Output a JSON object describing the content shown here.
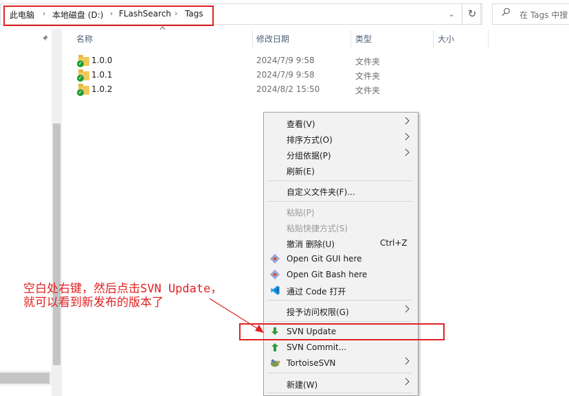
{
  "address_bar": {
    "breadcrumb": [
      "此电脑",
      "本地磁盘 (D:)",
      "FLashSearch",
      "Tags"
    ],
    "separator": "›",
    "dropdown_glyph": "⌄",
    "refresh_glyph": "↻"
  },
  "search": {
    "placeholder": "在 Tags 中搜",
    "icon": "search-icon"
  },
  "columns": {
    "name": "名称",
    "modified": "修改日期",
    "type": "类型",
    "size": "大小"
  },
  "files": [
    {
      "name": "1.0.0",
      "modified": "2024/7/9 9:58",
      "type": "文件夹"
    },
    {
      "name": "1.0.1",
      "modified": "2024/7/9 9:58",
      "type": "文件夹"
    },
    {
      "name": "1.0.2",
      "modified": "2024/8/2 15:50",
      "type": "文件夹"
    }
  ],
  "context_menu": {
    "view": "查看(V)",
    "sort": "排序方式(O)",
    "group": "分组依据(P)",
    "refresh": "刷新(E)",
    "customize": "自定义文件夹(F)...",
    "paste": "粘贴(P)",
    "paste_shortcut": "粘贴快捷方式(S)",
    "undo_delete": "撤消 删除(U)",
    "undo_shortcut": "Ctrl+Z",
    "git_gui": "Open Git GUI here",
    "git_bash": "Open Git Bash here",
    "vscode": "通过 Code 打开",
    "grant_access": "授予访问权限(G)",
    "svn_update": "SVN Update",
    "svn_commit": "SVN Commit...",
    "tortoise": "TortoiseSVN",
    "new": "新建(W)"
  },
  "annotation": {
    "line1": "空白处右键，然后点击SVN Update，",
    "line2": "就可以看到新发布的版本了",
    "color": "#e02020"
  }
}
